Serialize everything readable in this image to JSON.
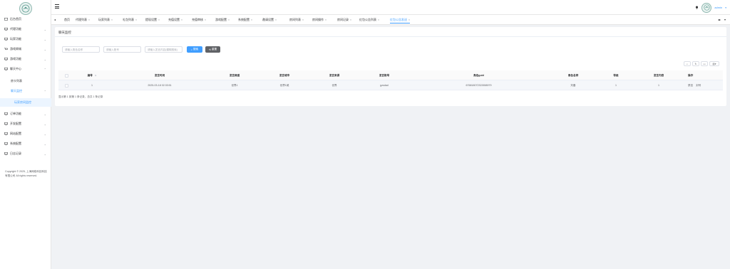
{
  "sidebar": {
    "items": [
      {
        "label": "后台首页",
        "icon": "home-icon"
      },
      {
        "label": "代理功能",
        "icon": "monitor-icon"
      },
      {
        "label": "玩家功能",
        "icon": "monitor-icon"
      },
      {
        "label": "游戏商城",
        "icon": "cart-icon"
      },
      {
        "label": "游戏功能",
        "icon": "monitor-icon"
      },
      {
        "label": "聊天中心",
        "icon": "monitor-icon"
      }
    ],
    "sub_items": [
      {
        "label": "房卡列表"
      },
      {
        "label": "聊天监控"
      }
    ],
    "sub_sub_item": {
      "label": "玩家房间监控"
    },
    "items_after": [
      {
        "label": "订单功能"
      },
      {
        "label": "开发配置"
      },
      {
        "label": "网站配置"
      },
      {
        "label": "系统配置"
      },
      {
        "label": "日志记录"
      }
    ],
    "copyright": "Copyright © 2025, 上海网络科技科技有限公司 All rights reserved."
  },
  "header": {
    "user_name": "admin"
  },
  "tabs": [
    {
      "label": "首页"
    },
    {
      "label": "代理列表"
    },
    {
      "label": "玩家列表"
    },
    {
      "label": "礼包列表"
    },
    {
      "label": "提现设置"
    },
    {
      "label": "充值设置"
    },
    {
      "label": "充值审核"
    },
    {
      "label": "游戏配置"
    },
    {
      "label": "系统配置"
    },
    {
      "label": "邀请设置"
    },
    {
      "label": "房间列表"
    },
    {
      "label": "房间操作"
    },
    {
      "label": "房间记录"
    },
    {
      "label": "红包公告列表"
    },
    {
      "label": "红包公告发送"
    }
  ],
  "active_tab_index": 14,
  "card": {
    "title": "聊天监控"
  },
  "search": {
    "field1_placeholder": "请输入角色名称",
    "field2_placeholder": "请输入账号",
    "field3_placeholder": "请输入发言内容(模糊搜索)",
    "search_label": "搜索",
    "reset_label": "重置"
  },
  "table": {
    "headers": [
      "编号",
      "发言时间",
      "发言频道",
      "发言城市",
      "发言来源",
      "发言账号",
      "角色guid",
      "角色名称",
      "等级",
      "发言内容",
      "操作"
    ],
    "rows": [
      {
        "id": "1",
        "time": "2025-03-18 02:33:51",
        "channel": "世界1",
        "city": "世界1城",
        "source": "世界",
        "account": "gzsdad",
        "guid": "676818072322658979",
        "role": "刘备",
        "level": "1",
        "content": "1",
        "op1": "禁言",
        "op2": "封号"
      }
    ]
  },
  "pagination_text": "显示第 1 到第 1 条记录，总共 1 条记录"
}
